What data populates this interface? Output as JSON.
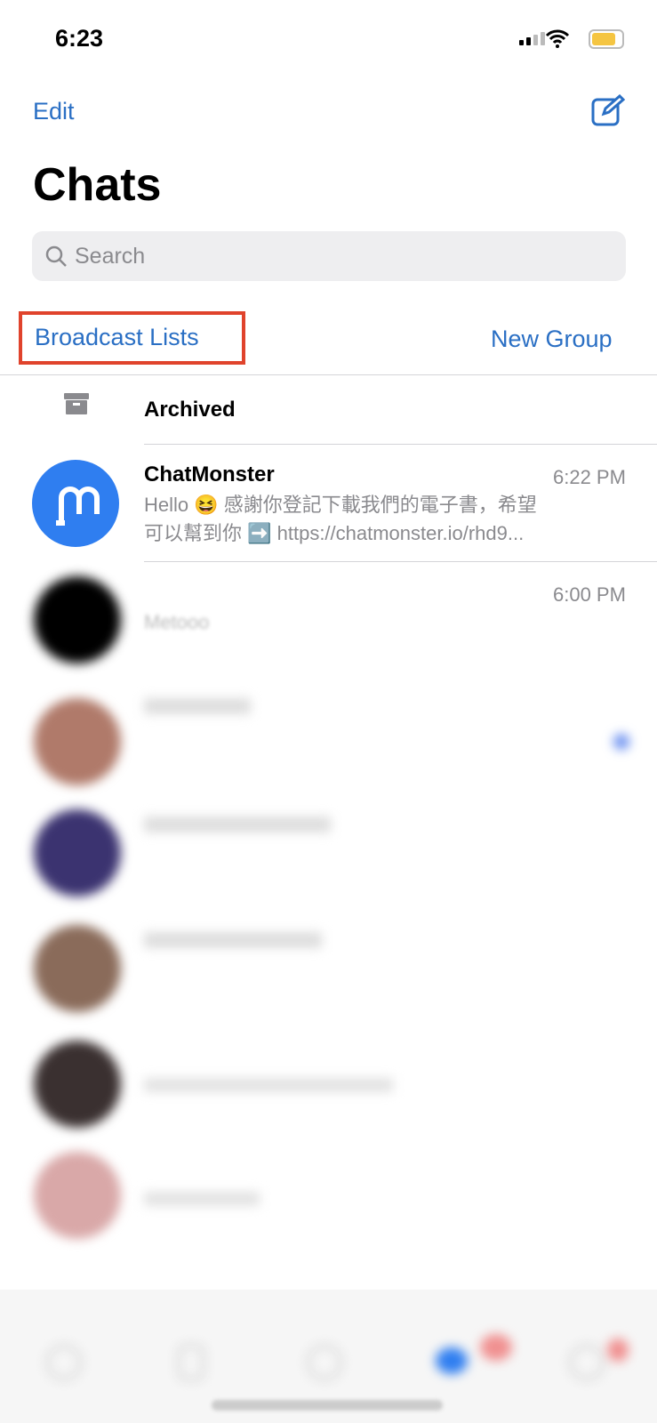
{
  "status": {
    "time": "6:23"
  },
  "header": {
    "edit": "Edit",
    "title": "Chats",
    "search_placeholder": "Search"
  },
  "links": {
    "broadcast": "Broadcast Lists",
    "new_group": "New Group"
  },
  "archived": {
    "label": "Archived"
  },
  "chats": [
    {
      "name": "ChatMonster",
      "time": "6:22 PM",
      "preview_line1": "Hello 😆 感謝你登記下載我們的電子書，希望",
      "preview_line2": "可以幫到你 ➡️ https://chatmonster.io/rhd9...",
      "avatar_color": "#2f7ef0"
    },
    {
      "name": "",
      "time": "6:00 PM",
      "preview_line1": "Metooo",
      "blurred": true
    }
  ],
  "colors": {
    "accent": "#2a6fc4",
    "highlight_box": "#e0432c"
  }
}
